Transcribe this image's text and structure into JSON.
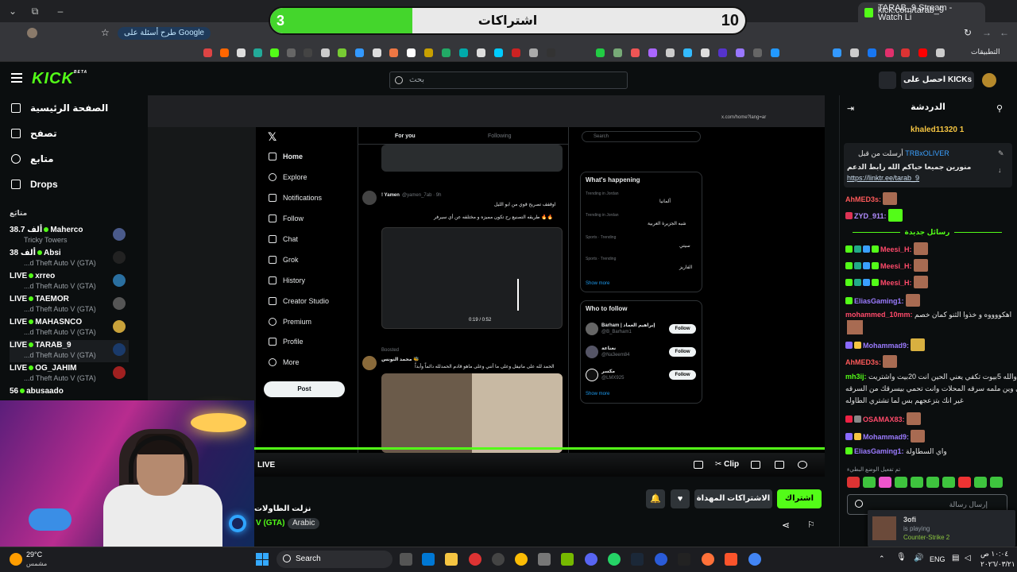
{
  "browser": {
    "tab_title": "TARAB_9 Stream - Watch Li",
    "url": "kick.com/tarab_9",
    "ask_google": "طرح أسئلة على Google",
    "apps_label": "التطبيقات"
  },
  "goal": {
    "current": "3",
    "target": "10",
    "title": "اشتراكات",
    "progress_fraction": 0.3
  },
  "topbar": {
    "logo": "KICK",
    "logo_sup": "BETA",
    "search_placeholder": "بحث",
    "get_kicks": "احصل على KICKs"
  },
  "sidebar": {
    "nav": [
      {
        "label": "الصفحة الرئيسية",
        "icon": "home-icon"
      },
      {
        "label": "تصفح",
        "icon": "browse-icon"
      },
      {
        "label": "متابع",
        "icon": "heart-icon"
      },
      {
        "label": "Drops",
        "icon": "drops-icon"
      }
    ],
    "following_label": "متابَع",
    "channels": [
      {
        "status": "38.7 ألف",
        "name": "Maherco",
        "game": "Tricky Towers"
      },
      {
        "status": "38 ألف",
        "name": "Absi",
        "game": "...d Theft Auto V (GTA)"
      },
      {
        "status": "LIVE",
        "name": "xrreo",
        "game": "...d Theft Auto V (GTA)"
      },
      {
        "status": "LIVE",
        "name": "TAEMOR",
        "game": "...d Theft Auto V (GTA)"
      },
      {
        "status": "LIVE",
        "name": "MAHASNCO",
        "game": "...d Theft Auto V (GTA)"
      },
      {
        "status": "LIVE",
        "name": "TARAB_9",
        "game": "...d Theft Auto V (GTA)"
      },
      {
        "status": "LIVE",
        "name": "OG_JAHIM",
        "game": "...d Theft Auto V (GTA)"
      },
      {
        "status": "56",
        "name": "abusaado",
        "game": ""
      }
    ]
  },
  "stream": {
    "inner_url": "x.com/home?lang=ar",
    "live_label": "LIVE",
    "clip_label": "Clip",
    "title": "نزلت الطاولات",
    "category": "V (GTA)",
    "language": "Arabic",
    "subscribe": "اشتراك",
    "gift_subs": "الاشتراكات المهداة"
  },
  "x_page": {
    "nav": [
      "Home",
      "Explore",
      "Notifications",
      "Follow",
      "Chat",
      "Grok",
      "History",
      "Creator Studio",
      "Premium",
      "Profile",
      "More"
    ],
    "post_button": "Post",
    "tabs": {
      "for_you": "For you",
      "following": "Following"
    },
    "tweet1_author": "! Yamen",
    "tweet1_handle": "@yamen_7ab · 9h",
    "tweet1_line1": "اوقفف تصريح قوي من ابو الليل",
    "tweet1_line2": "طريقه التصنيع رح تكون مميزه و مختلفه عن أي سيرفر 🔥🔥",
    "video_time": "0:19 / 0:52",
    "boosted": "Boosted",
    "tweet2_author": "محمد النونس 🐝",
    "tweet2_line": "الحمد لله على ماتيفل وعلى ما أنني وعلى ماهو قادم الحمدلله دائماً وأبداً",
    "search_placeholder": "Search",
    "whats_happening": "What's happening",
    "trends": [
      "ألمانيا",
      "شبه الجزيرة العربية",
      "سيتي",
      "الفاريز"
    ],
    "trend_context": [
      "Trending in Jordan",
      "Trending in Jordan",
      "Sports · Trending",
      "Sports · Trending"
    ],
    "show_more": "Show more",
    "who_to_follow": "Who to follow",
    "suggestions": [
      {
        "name": "Barham | إبراهيم العماد",
        "handle": "@B_Barham1"
      },
      {
        "name": "نعناعة",
        "handle": "@Na3eem84"
      },
      {
        "name": "مكسر",
        "handle": "@LMX925"
      }
    ],
    "follow_label": "Follow"
  },
  "chat": {
    "header": "الدردشة",
    "top_gifter": "khaled11320",
    "top_gifter_count": "1",
    "pinned_by": "أرسلت من قبل",
    "pinned_user": "TRBxOLIVER",
    "pinned_text": "منورين جميعا حياكم الله رابط الدعم",
    "pinned_link": "https://linktr.ee/tarab_9",
    "new_messages": "رسائل جديدة",
    "messages": [
      {
        "user": "AhMED3s:",
        "text": "",
        "color": "#ff5a5a"
      },
      {
        "user": "ZYD_911:",
        "text": "",
        "color": "#b18cff"
      },
      {
        "user": "Meesi_H:",
        "text": "",
        "color": "#ff4a6a"
      },
      {
        "user": "Meesi_H:",
        "text": "",
        "color": "#ff4a6a"
      },
      {
        "user": "Meesi_H:",
        "text": "",
        "color": "#ff4a6a"
      },
      {
        "user": "EliasGaming1:",
        "text": "",
        "color": "#9b7bff"
      },
      {
        "user": "mohammed_10mm:",
        "text": "اهكووووه و خذوا الثنو كمان خصم",
        "color": "#ff4a6a"
      },
      {
        "user": "Mohammad9:",
        "text": "",
        "color": "#9b7bff"
      },
      {
        "user": "AhMED3s:",
        "text": "",
        "color": "#ff5a5a"
      },
      {
        "user": "mh3ij:",
        "text": "والله 5بيوت تكفي يعني الحين انت 20بيت واشتريت",
        "color": "#53fc18"
      },
      {
        "user": "",
        "text": "كل شي وين ملمه سرقه المحلات وانت تحمي بيسرقك من السرقه",
        "color": "#e5e5e5"
      },
      {
        "user": "",
        "text": "غير انك بتزعجهم بس لما تشتري الطاوله",
        "color": "#e5e5e5"
      },
      {
        "user": "OSAMAX83:",
        "text": "",
        "color": "#ff4a6a"
      },
      {
        "user": "Mohammad9:",
        "text": "",
        "color": "#9b7bff"
      },
      {
        "user": "EliasGaming1:",
        "text": "واي السطاولة",
        "color": "#9b7bff"
      }
    ],
    "slow_mode": "تم تفعيل الوضع البطيء",
    "input_placeholder": "إرسال رسالة"
  },
  "toast": {
    "name": "3ofi",
    "status": "is playing",
    "game": "Counter-Strike 2"
  },
  "taskbar": {
    "temp": "29°C",
    "weather": "مشمس",
    "search": "Search",
    "lang": "ENG",
    "time": "١٠:٠٤ ص",
    "date": "٢٠٢٦/٠٣/٢١"
  }
}
